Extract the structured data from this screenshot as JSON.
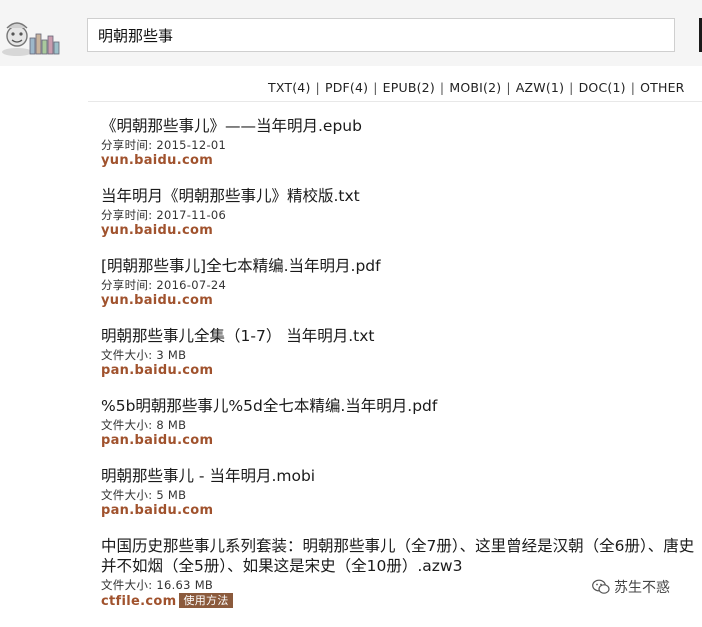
{
  "search": {
    "query": "明朝那些事"
  },
  "filters": [
    {
      "label": "TXT(4)"
    },
    {
      "label": "PDF(4)"
    },
    {
      "label": "EPUB(2)"
    },
    {
      "label": "MOBI(2)"
    },
    {
      "label": "AZW(1)"
    },
    {
      "label": "DOC(1)"
    },
    {
      "label": "OTHER"
    }
  ],
  "results": [
    {
      "title": "《明朝那些事儿》——当年明月.epub",
      "meta": "分享时间: 2015-12-01",
      "host": "yun.baidu.com"
    },
    {
      "title": "当年明月《明朝那些事儿》精校版.txt",
      "meta": "分享时间: 2017-11-06",
      "host": "yun.baidu.com"
    },
    {
      "title": "[明朝那些事儿]全七本精编.当年明月.pdf",
      "meta": "分享时间: 2016-07-24",
      "host": "yun.baidu.com"
    },
    {
      "title": "明朝那些事儿全集（1-7） 当年明月.txt",
      "meta": "文件大小: 3 MB",
      "host": "pan.baidu.com"
    },
    {
      "title": "%5b明朝那些事儿%5d全七本精编.当年明月.pdf",
      "meta": "文件大小: 8 MB",
      "host": "pan.baidu.com"
    },
    {
      "title": "明朝那些事儿 - 当年明月.mobi",
      "meta": "文件大小: 5 MB",
      "host": "pan.baidu.com"
    },
    {
      "title": "中国历史那些事儿系列套装：明朝那些事儿（全7册）、这里曾经是汉朝（全6册）、唐史并不如烟（全5册）、如果这是宋史（全10册）.azw3",
      "meta": "文件大小: 16.63 MB",
      "host": "ctfile.com",
      "badge": "使用方法"
    }
  ],
  "watermark": {
    "text": "苏生不惑"
  }
}
